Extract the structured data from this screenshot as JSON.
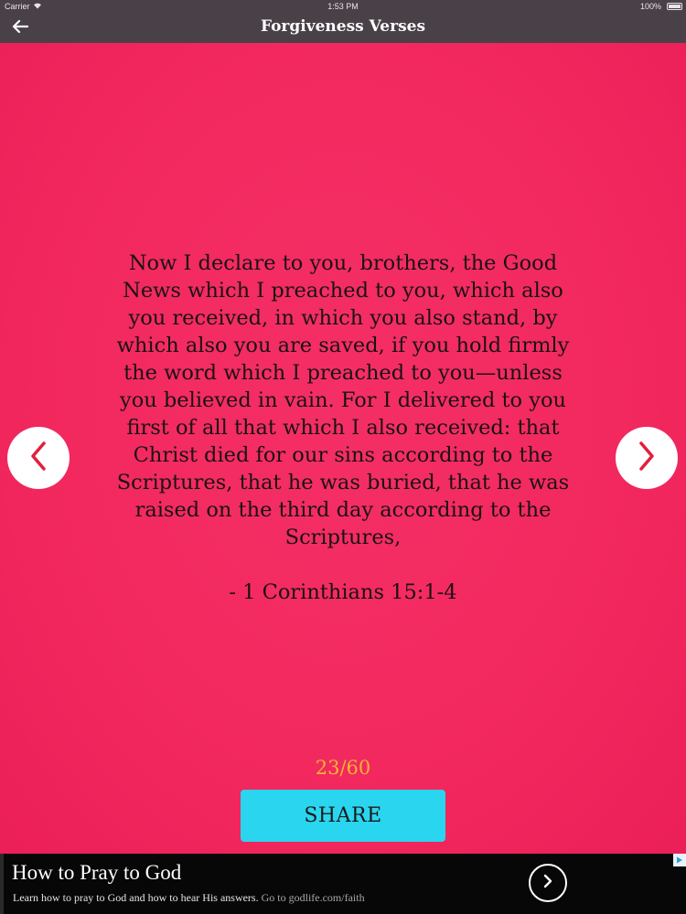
{
  "status_bar": {
    "carrier": "Carrier",
    "time": "1:53 PM",
    "battery": "100%"
  },
  "nav_bar": {
    "title": "Forgiveness Verses",
    "back_icon": "arrow-left-icon"
  },
  "verse": {
    "lines": [
      "Now I declare to you, brothers, the Good",
      "News which I preached to you, which also",
      "you received, in which you also stand, by",
      "which also you are saved, if you hold firmly",
      "the word which I preached to you—unless",
      "you believed in vain. For I delivered to you",
      "first of all that which I also received: that",
      "Christ died for our sins according to the",
      "Scriptures, that he was buried, that he was",
      "raised on the third day according to the",
      "Scriptures,"
    ],
    "reference": "- 1 Corinthians 15:1-4"
  },
  "pager": {
    "counter": "23/60",
    "current": 23,
    "total": 60,
    "prev_icon": "chevron-left-icon",
    "next_icon": "chevron-right-icon"
  },
  "share": {
    "label": "SHARE"
  },
  "ad": {
    "title": "How to Pray to God",
    "description": "Learn how to pray to God and how to hear His answers.",
    "link_text": "Go to godlife.com/faith",
    "arrow_icon": "chevron-right-icon"
  },
  "colors": {
    "nav_bar": "#4a4148",
    "background": "#f2295f",
    "counter": "#f5b331",
    "share_button": "#2ad5ef",
    "chevron": "#e0203f"
  }
}
